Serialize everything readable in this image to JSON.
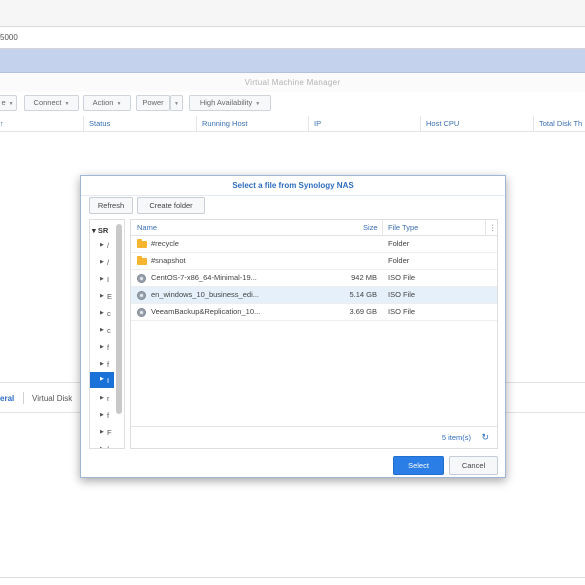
{
  "browser": {
    "address_text": "5000"
  },
  "app": {
    "title": "Virtual Machine Manager"
  },
  "toolbar": {
    "buttons": [
      {
        "label": "e"
      },
      {
        "label": "Connect"
      },
      {
        "label": "Action"
      },
      {
        "label": "Power"
      },
      {
        "label": "High Availability"
      }
    ]
  },
  "grid": {
    "columns": [
      "↑",
      "Status",
      "Running Host",
      "IP",
      "Host CPU",
      "Total Disk Th"
    ]
  },
  "bottom_tabs": [
    {
      "label": "eral"
    },
    {
      "label": "Virtual Disk"
    }
  ],
  "dialog": {
    "title": "Select a file from Synology NAS",
    "refresh_label": "Refresh",
    "create_folder_label": "Create folder",
    "tree": {
      "root_label": "SR",
      "items": [
        "/",
        "/",
        "I",
        "E",
        "c",
        "c",
        "f",
        "f",
        "I",
        "r",
        "f",
        "F",
        "f",
        "E"
      ]
    },
    "columns": {
      "name": "Name",
      "size": "Size",
      "type": "File Type"
    },
    "files": [
      {
        "name": "#recycle",
        "size": "",
        "type": "Folder",
        "icon": "folder-icon"
      },
      {
        "name": "#snapshot",
        "size": "",
        "type": "Folder",
        "icon": "folder-icon"
      },
      {
        "name": "CentOS-7-x86_64-Minimal-19...",
        "size": "942 MB",
        "type": "ISO File",
        "icon": "iso-file-icon"
      },
      {
        "name": "en_windows_10_business_edi...",
        "size": "5.14 GB",
        "type": "ISO File",
        "icon": "iso-file-icon"
      },
      {
        "name": "VeeamBackup&Replication_10...",
        "size": "3.69 GB",
        "type": "ISO File",
        "icon": "iso-file-icon"
      }
    ],
    "selected_row_index": 3,
    "item_count": "5 item(s)",
    "select_label": "Select",
    "cancel_label": "Cancel"
  },
  "colors": {
    "accent": "#2a7ee6",
    "header_blue": "#c5d2ee",
    "tree_selected": "#1a72d9",
    "row_selected": "#e6f0fb",
    "folder": "#f5b531"
  }
}
